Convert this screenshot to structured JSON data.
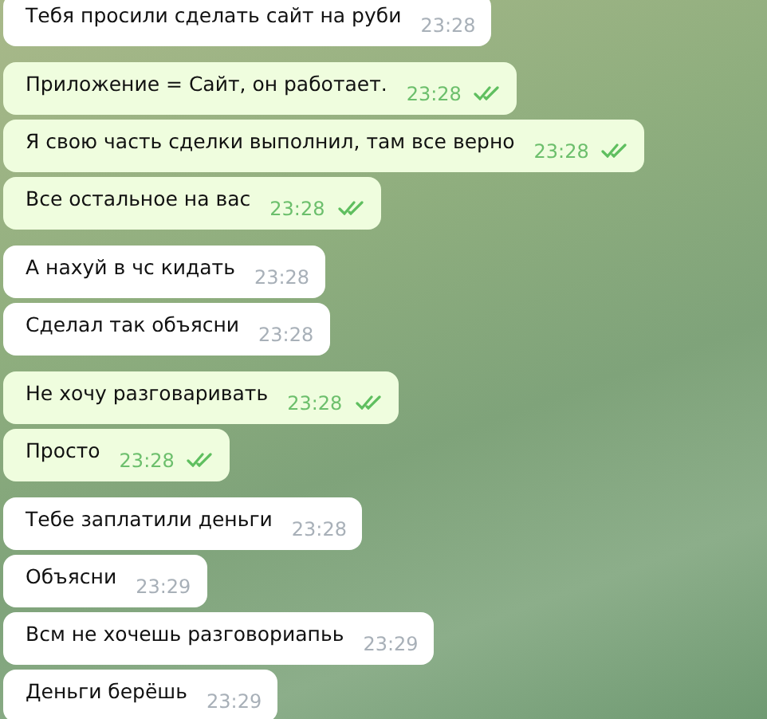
{
  "messages": [
    {
      "kind": "incoming",
      "text": "Тебя просили сделать сайт на руби",
      "time": "23:28"
    },
    {
      "kind": "outgoing",
      "text": "Приложение = Сайт, он работает.",
      "time": "23:28",
      "read": true
    },
    {
      "kind": "outgoing",
      "text": "Я свою часть сделки выполнил, там все верно",
      "time": "23:28",
      "read": true
    },
    {
      "kind": "outgoing",
      "text": "Все остальное на вас",
      "time": "23:28",
      "read": true
    },
    {
      "kind": "incoming",
      "text": "А нахуй в чс кидать",
      "time": "23:28"
    },
    {
      "kind": "incoming",
      "text": "Сделал так объясни",
      "time": "23:28"
    },
    {
      "kind": "outgoing",
      "text": "Не хочу разговаривать",
      "time": "23:28",
      "read": true
    },
    {
      "kind": "outgoing",
      "text": "Просто",
      "time": "23:28",
      "read": true
    },
    {
      "kind": "incoming",
      "text": "Тебе заплатили деньги",
      "time": "23:28"
    },
    {
      "kind": "incoming",
      "text": "Объясни",
      "time": "23:29"
    },
    {
      "kind": "incoming",
      "text": "Всм не хочешь разговориапьь",
      "time": "23:29"
    },
    {
      "kind": "incoming",
      "text": "Деньги берёшь",
      "time": "23:29"
    }
  ]
}
